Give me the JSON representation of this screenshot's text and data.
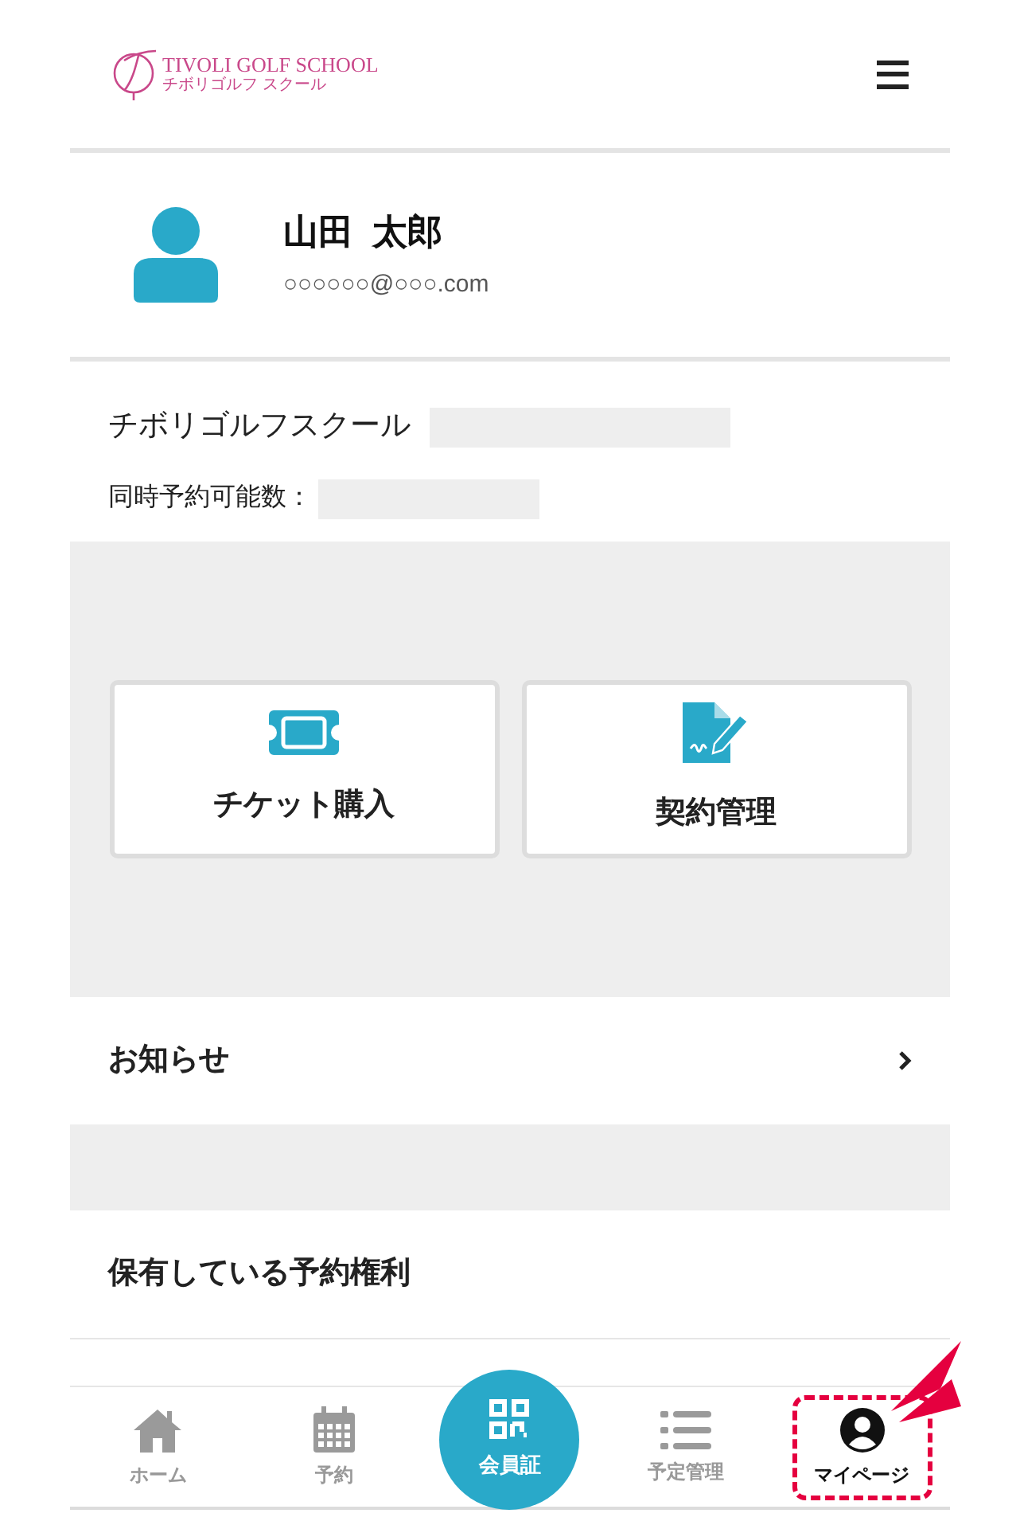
{
  "header": {
    "logo_title": "TIVOLI GOLF SCHOOL",
    "logo_subtitle": "チボリゴルフ スクール"
  },
  "profile": {
    "name": "山田  太郎",
    "email": "○○○○○○@○○○.com"
  },
  "info": [
    {
      "label": "チボリゴルフスクール",
      "kind": "school"
    },
    {
      "label": "同時予約可能数：",
      "kind": "count"
    }
  ],
  "cards": [
    {
      "label": "チケット購入",
      "kind": "ticket"
    },
    {
      "label": "契約管理",
      "kind": "contract"
    }
  ],
  "sections": [
    {
      "label": "お知らせ",
      "kind": "link"
    },
    {
      "label": "保有している予約権利",
      "kind": "plain"
    }
  ],
  "nav": [
    {
      "label": "ホーム",
      "kind": "home",
      "selected": false
    },
    {
      "label": "予約",
      "kind": "calendar",
      "selected": false
    },
    {
      "label": "会員証",
      "kind": "qr",
      "selected": false
    },
    {
      "label": "予定管理",
      "kind": "list",
      "selected": false
    },
    {
      "label": "マイページ",
      "kind": "user",
      "selected": true
    }
  ]
}
